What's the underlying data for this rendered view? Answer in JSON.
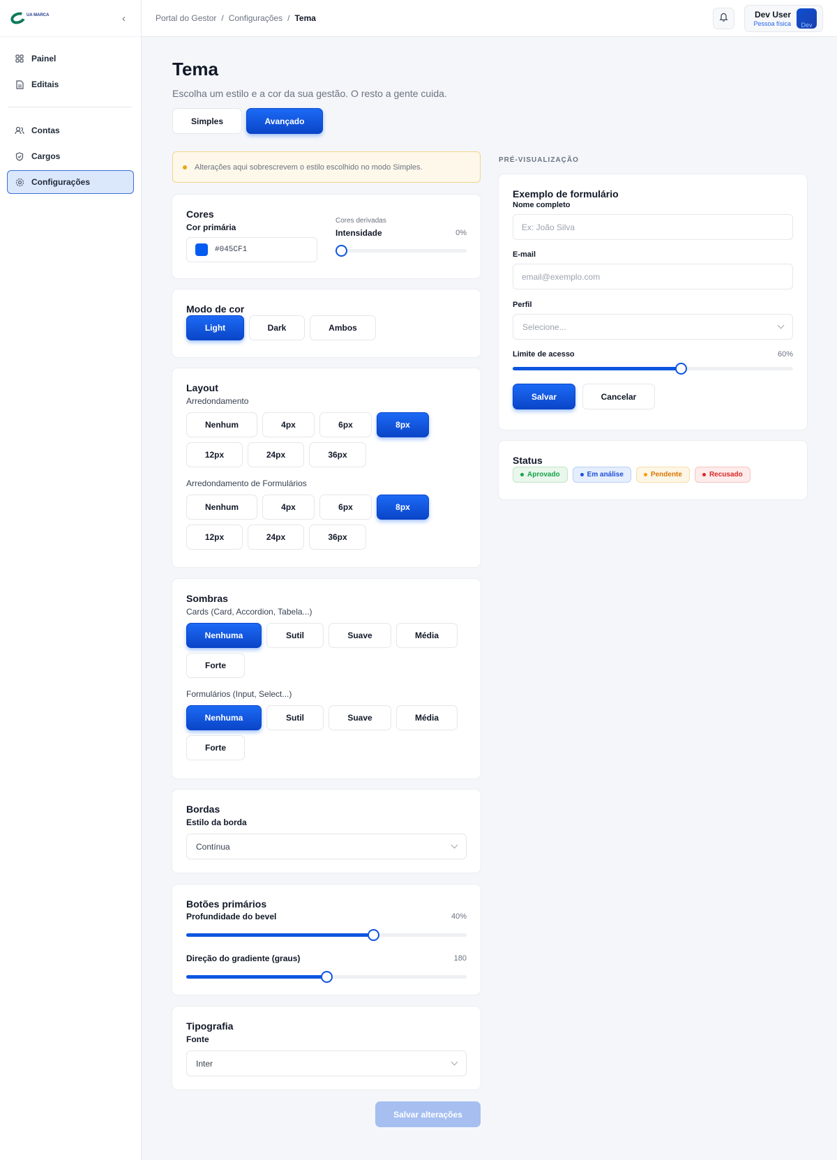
{
  "sidebar": {
    "logo_text": "UA MARCA",
    "items": [
      {
        "label": "Painel",
        "icon": "grid-icon"
      },
      {
        "label": "Editais",
        "icon": "document-icon"
      },
      {
        "label": "Contas",
        "icon": "users-icon"
      },
      {
        "label": "Cargos",
        "icon": "shield-icon"
      },
      {
        "label": "Configurações",
        "icon": "gear-icon",
        "active": true
      }
    ]
  },
  "topbar": {
    "breadcrumb": [
      "Portal do Gestor",
      "Configurações",
      "Tema"
    ],
    "user_name": "Dev User",
    "user_type": "Pessoa física",
    "avatar_alt": "Dev"
  },
  "page": {
    "title": "Tema",
    "subtitle": "Escolha um estilo e a cor da sua gestão. O resto a gente cuida.",
    "mode_tabs": [
      "Simples",
      "Avançado"
    ],
    "active_mode": "Avançado",
    "notice": "Alterações aqui sobrescrevem o estilo escolhido no modo Simples."
  },
  "colors": {
    "title": "Cores",
    "primary_label": "Cor primária",
    "primary_hex": "#045CF1",
    "derived_label": "Cores derivadas",
    "intensity_label": "Intensidade",
    "intensity_value": "0%",
    "intensity_fraction": 0
  },
  "color_mode": {
    "title": "Modo de cor",
    "options": [
      "Light",
      "Dark",
      "Ambos"
    ],
    "selected": "Light"
  },
  "layout": {
    "title": "Layout",
    "rounding_label": "Arredondamento",
    "rounding_options": [
      "Nenhum",
      "4px",
      "6px",
      "8px",
      "12px",
      "24px",
      "36px"
    ],
    "rounding_selected": "8px",
    "form_rounding_label": "Arredondamento de Formulários",
    "form_rounding_options": [
      "Nenhum",
      "4px",
      "6px",
      "8px",
      "12px",
      "24px",
      "36px"
    ],
    "form_rounding_selected": "8px"
  },
  "shadows": {
    "title": "Sombras",
    "cards_label": "Cards (Card, Accordion, Tabela...)",
    "cards_options": [
      "Nenhuma",
      "Sutil",
      "Suave",
      "Média",
      "Forte"
    ],
    "cards_selected": "Nenhuma",
    "forms_label": "Formulários (Input, Select...)",
    "forms_options": [
      "Nenhuma",
      "Sutil",
      "Suave",
      "Média",
      "Forte"
    ],
    "forms_selected": "Nenhuma"
  },
  "borders": {
    "title": "Bordas",
    "style_label": "Estilo da borda",
    "style_value": "Contínua"
  },
  "primary_buttons": {
    "title": "Botões primários",
    "bevel_label": "Profundidade do bevel",
    "bevel_value": "40%",
    "bevel_fraction": 0.667,
    "gradient_label": "Direção do gradiente (graus)",
    "gradient_value": "180",
    "gradient_fraction": 0.5
  },
  "typography": {
    "title": "Tipografia",
    "font_label": "Fonte",
    "font_value": "Inter"
  },
  "save_all_label": "Salvar alterações",
  "preview": {
    "label": "PRÉ-VISUALIZAÇÃO",
    "form_title": "Exemplo de formulário",
    "name_label": "Nome completo",
    "name_placeholder": "Ex: João Silva",
    "email_label": "E-mail",
    "email_placeholder": "email@exemplo.com",
    "profile_label": "Perfil",
    "profile_placeholder": "Selecione...",
    "limit_label": "Limite de acesso",
    "limit_value": "60%",
    "limit_fraction": 0.6,
    "save_label": "Salvar",
    "cancel_label": "Cancelar",
    "status_title": "Status",
    "badges": [
      {
        "label": "Aprovado",
        "color": "#16a34a",
        "bg": "#eaf7ec",
        "border": "#bfe6c6"
      },
      {
        "label": "Em análise",
        "color": "#1d4ed8",
        "bg": "#e5eefc",
        "border": "#b9cff5"
      },
      {
        "label": "Pendente",
        "color": "#d97706",
        "bg": "#fdf6e6",
        "border": "#f5dfaa"
      },
      {
        "label": "Recusado",
        "color": "#dc2626",
        "bg": "#fdeceb",
        "border": "#f5c4c1"
      }
    ]
  },
  "accent_color": "#045CF1"
}
